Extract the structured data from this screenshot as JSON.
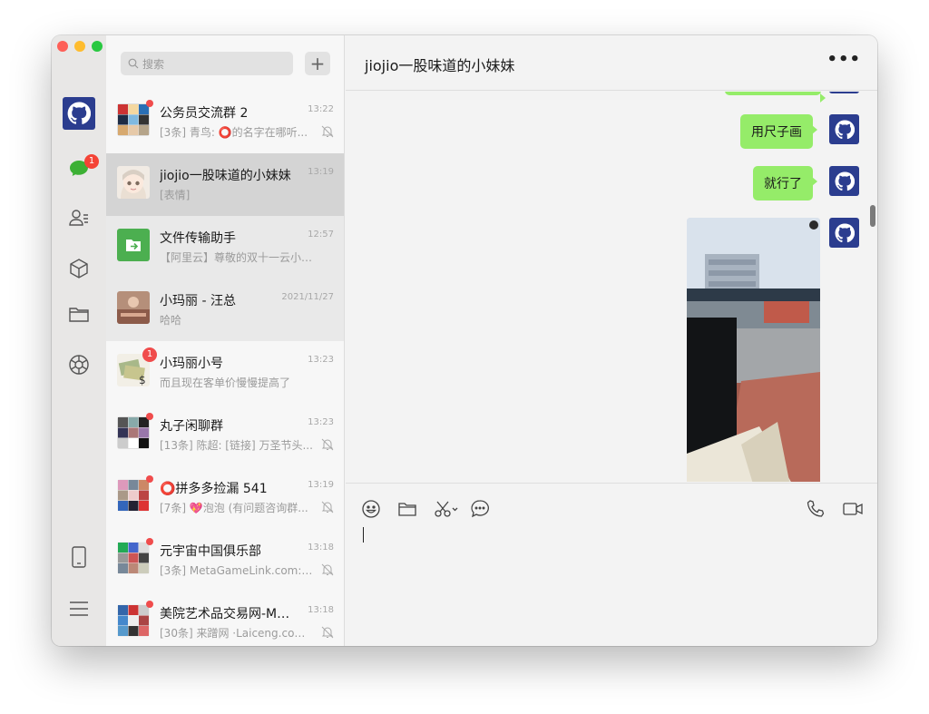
{
  "colors": {
    "accent_bubble": "#95ec69",
    "badge_red": "#f04c4c",
    "avatar_blue": "#2b3d8f"
  },
  "rail": {
    "chat_badge": "1"
  },
  "search": {
    "placeholder": "搜索",
    "add_label": "+"
  },
  "conversations": [
    {
      "name": "公务员交流群 2",
      "time": "13:22",
      "preview": "[3条] 青鸟: ⭕的名字在哪听...",
      "muted": true,
      "dot": true
    },
    {
      "name": "jiojio一股味道的小妹妹",
      "time": "13:19",
      "preview": "[表情]",
      "selected": true
    },
    {
      "name": "文件传输助手",
      "time": "12:57",
      "preview": "【阿里云】尊敬的双十一云小宝..."
    },
    {
      "name": "小玛丽 - 汪总",
      "time": "2021/11/27",
      "preview": "哈哈"
    },
    {
      "name": "小玛丽小号",
      "time": "13:23",
      "preview": "而且现在客单价慢慢提高了",
      "count": "1"
    },
    {
      "name": "丸子闲聊群",
      "time": "13:23",
      "preview": "[13条] 陈超: [链接] 万圣节头...",
      "muted": true,
      "dot": true
    },
    {
      "name": "⭕拼多多捡漏 541",
      "time": "13:19",
      "preview": "[7条] 💖泡泡 (有问题咨询群...",
      "muted": true,
      "dot": true
    },
    {
      "name": "元宇宙中国俱乐部",
      "time": "13:18",
      "preview": "[3条] MetaGameLink.com: nf...",
      "muted": true,
      "dot": true
    },
    {
      "name": "美院艺术品交易网-Me...",
      "time": "13:18",
      "preview": "[30条] 来蹭网 ·Laiceng.com:...",
      "muted": true,
      "dot": true
    }
  ],
  "chat": {
    "title": "jiojio一股味道的小妹妹",
    "more_label": "•••",
    "messages": [
      {
        "text": "用尺子画"
      },
      {
        "text": "就行了"
      }
    ]
  },
  "composer": {
    "tools": [
      "emoji-icon",
      "folder-icon",
      "scissors-icon",
      "chat-bubble-icon"
    ],
    "right_tools": [
      "phone-icon",
      "video-icon"
    ]
  }
}
